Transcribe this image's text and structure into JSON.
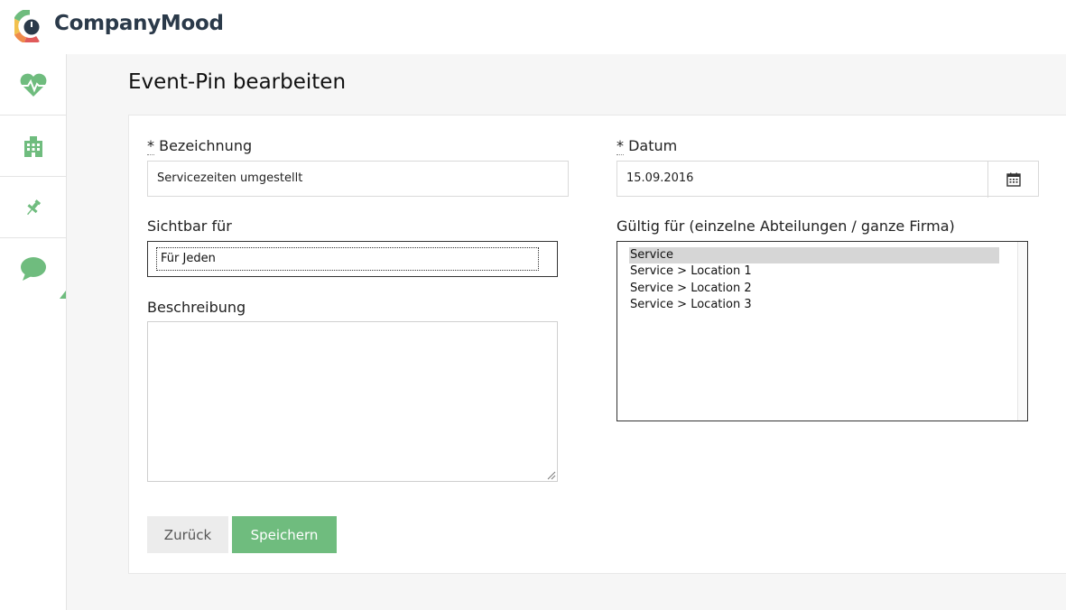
{
  "app": {
    "brand": "CompanyMood"
  },
  "colors": {
    "accent": "#6fbc7e",
    "brand_text": "#2b3a4a"
  },
  "sidebar": {
    "items": [
      {
        "icon": "heartbeat-icon"
      },
      {
        "icon": "building-icon"
      },
      {
        "icon": "pin-icon"
      },
      {
        "icon": "chat-bubble-icon"
      }
    ]
  },
  "page": {
    "title": "Event-Pin bearbeiten"
  },
  "form": {
    "name": {
      "required_mark": "*",
      "label": "Bezeichnung",
      "value": "Servicezeiten umgestellt"
    },
    "date": {
      "required_mark": "*",
      "label": "Datum",
      "value": "15.09.2016",
      "button_icon": "calendar-icon"
    },
    "visibility": {
      "label": "Sichtbar für",
      "selected": "Für Jeden"
    },
    "valid_for": {
      "label": "Gültig für (einzelne Abteilungen / ganze Firma)",
      "options": [
        "Service",
        "Service > Location 1",
        "Service > Location 2",
        "Service > Location 3"
      ],
      "selected_index": 0
    },
    "description": {
      "label": "Beschreibung",
      "value": ""
    }
  },
  "actions": {
    "back_label": "Zurück",
    "save_label": "Speichern"
  }
}
